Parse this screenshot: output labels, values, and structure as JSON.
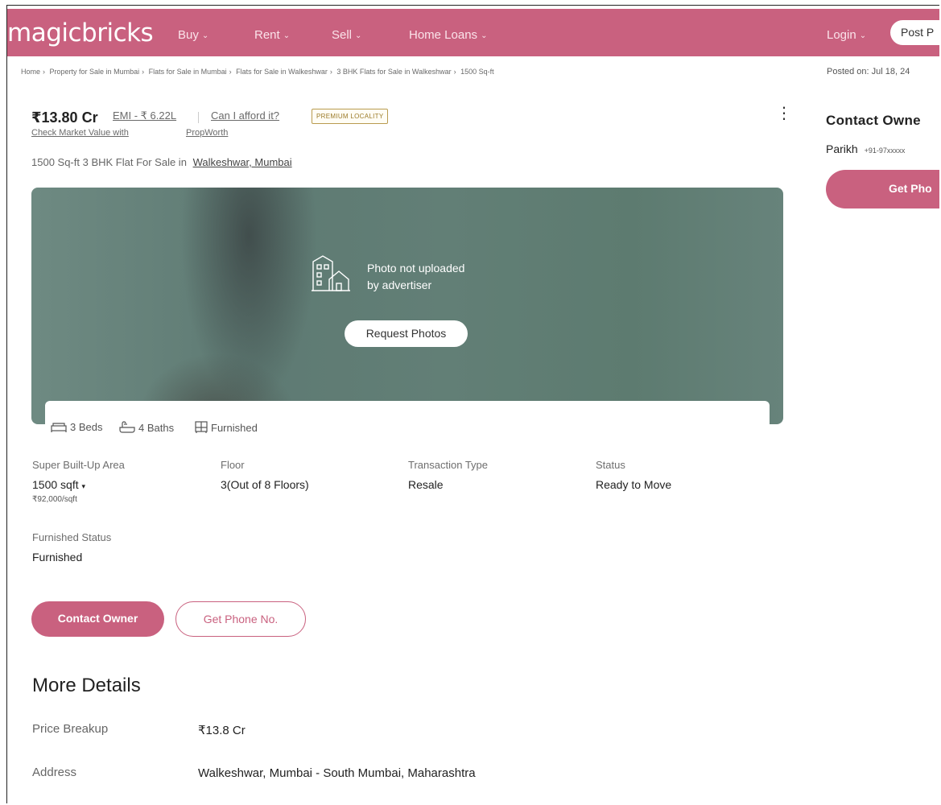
{
  "header": {
    "logo": "magicbricks",
    "nav": [
      {
        "label": "Buy"
      },
      {
        "label": "Rent"
      },
      {
        "label": "Sell"
      },
      {
        "label": "Home Loans"
      }
    ],
    "login": "Login",
    "post_button": "Post P"
  },
  "breadcrumb": [
    "Home",
    "Property for Sale in Mumbai",
    "Flats for Sale in Mumbai",
    "Flats for Sale in Walkeshwar",
    "3 BHK Flats for Sale in Walkeshwar",
    "1500 Sq-ft"
  ],
  "posted": "Posted on: Jul 18, 24",
  "listing": {
    "price": "₹13.80 Cr",
    "emi": "EMI - ₹ 6.22L",
    "afford": "Can I afford it?",
    "badge": "PREMIUM LOCALITY",
    "check_market": "Check Market Value with",
    "propworth": "PropWorth",
    "subtitle_prefix": "1500 Sq-ft 3 BHK Flat For Sale in",
    "subtitle_link": "Walkeshwar, Mumbai"
  },
  "photo": {
    "line1": "Photo not uploaded",
    "line2": "by advertiser",
    "request_button": "Request Photos"
  },
  "features": {
    "beds": "3 Beds",
    "baths": "4 Baths",
    "furnished": "Furnished"
  },
  "specs": {
    "area_label": "Super Built-Up Area",
    "area_value": "1500 sqft",
    "area_rate": "₹92,000/sqft",
    "floor_label": "Floor",
    "floor_value": "3(Out of 8 Floors)",
    "transaction_label": "Transaction Type",
    "transaction_value": "Resale",
    "status_label": "Status",
    "status_value": "Ready to Move",
    "furnished_label": "Furnished Status",
    "furnished_value": "Furnished"
  },
  "actions": {
    "contact_owner": "Contact Owner",
    "get_phone": "Get Phone No."
  },
  "more_details": {
    "title": "More Details",
    "rows": [
      {
        "label": "Price Breakup",
        "value": "₹13.8 Cr"
      },
      {
        "label": "Address",
        "value": "Walkeshwar, Mumbai - South Mumbai, Maharashtra"
      }
    ]
  },
  "sidebar": {
    "title": "Contact Owne",
    "owner_name": "Parikh",
    "owner_phone": "+91-97xxxxx",
    "button": "Get Pho"
  },
  "colors": {
    "brand": "#c9617f",
    "badge_border": "#b99b4f"
  }
}
